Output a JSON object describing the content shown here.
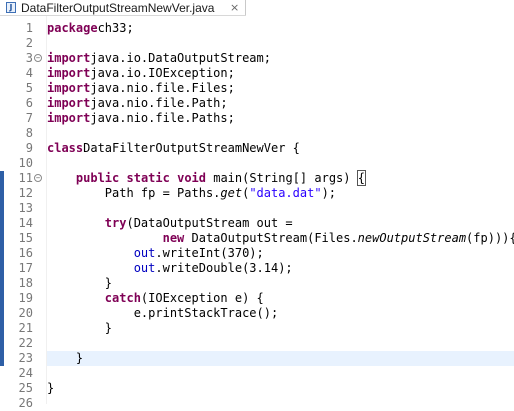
{
  "tab": {
    "title": "DataFilterOutputStreamNewVer.java",
    "icon": "java-file-icon",
    "close": "×"
  },
  "colors": {
    "keyword": "#7f0055",
    "string": "#2a00ff",
    "field": "#0000c0",
    "line_number": "#787878",
    "current_line": "#e8f2fe"
  },
  "editor": {
    "lines": [
      {
        "n": "1",
        "tokens": [
          [
            "kw",
            "package"
          ],
          [
            "",
            "ch33;"
          ]
        ]
      },
      {
        "n": "2",
        "tokens": []
      },
      {
        "n": "3",
        "fold": true,
        "tokens": [
          [
            "kw",
            "import"
          ],
          [
            "",
            "java.io.DataOutputStream;"
          ]
        ]
      },
      {
        "n": "4",
        "tokens": [
          [
            "kw",
            "import"
          ],
          [
            "",
            "java.io.IOException;"
          ]
        ]
      },
      {
        "n": "5",
        "tokens": [
          [
            "kw",
            "import"
          ],
          [
            "",
            "java.nio.file.Files;"
          ]
        ]
      },
      {
        "n": "6",
        "tokens": [
          [
            "kw",
            "import"
          ],
          [
            "",
            "java.nio.file.Path;"
          ]
        ]
      },
      {
        "n": "7",
        "tokens": [
          [
            "kw",
            "import"
          ],
          [
            "",
            "java.nio.file.Paths;"
          ]
        ]
      },
      {
        "n": "8",
        "tokens": []
      },
      {
        "n": "9",
        "tokens": [
          [
            "kw",
            "class"
          ],
          [
            "",
            "DataFilterOutputStreamNewVer {"
          ]
        ]
      },
      {
        "n": "10",
        "tokens": []
      },
      {
        "n": "11",
        "fold": true,
        "tokens": [
          [
            "",
            "    "
          ],
          [
            "kw",
            "public"
          ],
          [
            "",
            " "
          ],
          [
            "kw",
            "static"
          ],
          [
            "",
            " "
          ],
          [
            "kw",
            "void"
          ],
          [
            "",
            " main(String[] args) "
          ],
          [
            "brk",
            "{"
          ]
        ]
      },
      {
        "n": "12",
        "tokens": [
          [
            "",
            "        Path fp = Paths."
          ],
          [
            "it",
            "get"
          ],
          [
            "",
            "("
          ],
          [
            "str",
            "\"data.dat\""
          ],
          [
            "",
            ");"
          ]
        ]
      },
      {
        "n": "13",
        "tokens": []
      },
      {
        "n": "14",
        "tokens": [
          [
            "",
            "        "
          ],
          [
            "kw",
            "try"
          ],
          [
            "",
            "(DataOutputStream out ="
          ]
        ]
      },
      {
        "n": "15",
        "tokens": [
          [
            "",
            "                "
          ],
          [
            "kw",
            "new"
          ],
          [
            "",
            " DataOutputStream(Files."
          ],
          [
            "it",
            "newOutputStream"
          ],
          [
            "",
            "(fp))){"
          ]
        ]
      },
      {
        "n": "16",
        "tokens": [
          [
            "",
            "            "
          ],
          [
            "fld",
            "out"
          ],
          [
            "",
            ".writeInt(370);"
          ]
        ]
      },
      {
        "n": "17",
        "tokens": [
          [
            "",
            "            "
          ],
          [
            "fld",
            "out"
          ],
          [
            "",
            ".writeDouble(3.14);"
          ]
        ]
      },
      {
        "n": "18",
        "tokens": [
          [
            "",
            "        }"
          ]
        ]
      },
      {
        "n": "19",
        "tokens": [
          [
            "",
            "        "
          ],
          [
            "kw",
            "catch"
          ],
          [
            "",
            "(IOException e) {"
          ]
        ]
      },
      {
        "n": "20",
        "tokens": [
          [
            "",
            "            e.printStackTrace();"
          ]
        ]
      },
      {
        "n": "21",
        "tokens": [
          [
            "",
            "        }"
          ]
        ]
      },
      {
        "n": "22",
        "tokens": []
      },
      {
        "n": "23",
        "tokens": [
          [
            "",
            "    }"
          ]
        ]
      },
      {
        "n": "24",
        "tokens": []
      },
      {
        "n": "25",
        "tokens": [
          [
            "",
            "}"
          ]
        ]
      },
      {
        "n": "26",
        "tokens": []
      }
    ]
  }
}
